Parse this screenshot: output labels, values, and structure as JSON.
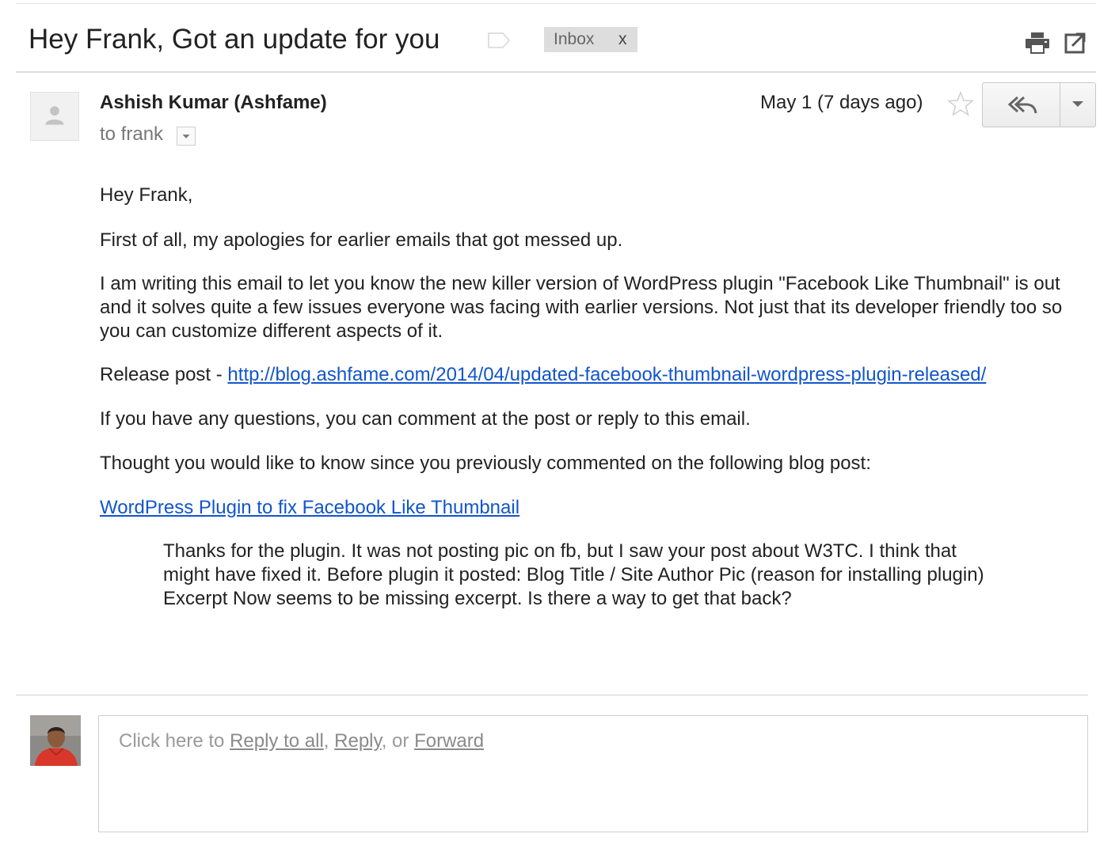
{
  "subject": "Hey Frank, Got an update for you",
  "labels": [
    {
      "name": "Inbox",
      "remove": "x"
    }
  ],
  "icons": {
    "label": "label-tag-icon",
    "print": "print-icon",
    "popout": "new-window-icon",
    "star": "star-icon",
    "reply_all": "reply-all-icon",
    "more": "chevron-down-icon",
    "sender_avatar": "person-placeholder-icon"
  },
  "message": {
    "sender": "Ashish Kumar (Ashfame)",
    "recipient": "to frank",
    "date": "May 1 (7 days ago)",
    "body": {
      "greeting": "Hey Frank,",
      "p1": "First of all, my apologies for earlier emails that got messed up.",
      "p2": "I am writing this email to let you know the new killer version of WordPress plugin \"Facebook Like Thumbnail\" is out and it solves quite a few issues everyone was facing with earlier versions. Not just that its developer friendly too so you can customize different aspects of it.",
      "release_prefix": "Release post - ",
      "release_link": "http://blog.ashfame.com/2014/04/updated-facebook-thumbnail-wordpress-plugin-released/",
      "questions": "If you have any questions, you can comment at the post or reply to this email.",
      "thought": "Thought you would like to know since you previously commented on the following blog post:",
      "post_link": "WordPress Plugin to fix Facebook Like Thumbnail",
      "quote": "Thanks for the plugin. It was not posting pic on fb, but I saw your post about W3TC. I think that might have fixed it. Before plugin it posted: Blog Title / Site Author Pic (reason for installing plugin) Excerpt Now seems to be missing excerpt. Is there a way to get that back?"
    }
  },
  "reply_box": {
    "prefix": "Click here to ",
    "reply_all": "Reply to all",
    "sep1": ", ",
    "reply": "Reply",
    "sep2": ", or ",
    "forward": "Forward"
  },
  "colors": {
    "link": "#1155cc",
    "chip_bg": "#dddddd",
    "muted_text": "#777777"
  }
}
